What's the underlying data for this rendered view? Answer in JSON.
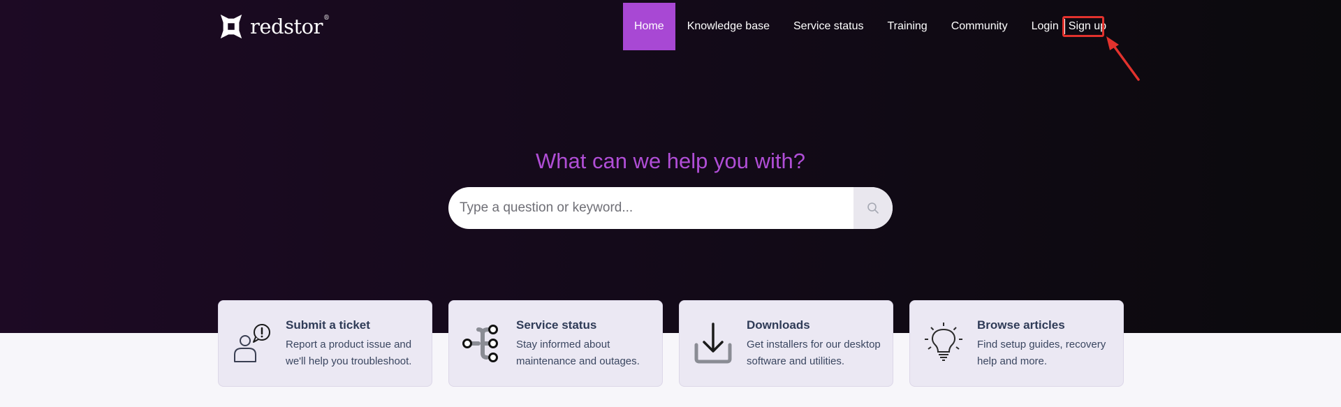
{
  "brand": {
    "name": "redstor",
    "tm": "®"
  },
  "nav": {
    "items": [
      {
        "label": "Home",
        "active": true
      },
      {
        "label": "Knowledge base",
        "active": false
      },
      {
        "label": "Service status",
        "active": false
      },
      {
        "label": "Training",
        "active": false
      },
      {
        "label": "Community",
        "active": false
      },
      {
        "label": "Login",
        "active": false
      },
      {
        "label": "Sign up",
        "active": false
      }
    ]
  },
  "hero": {
    "title": "What can we help you with?",
    "search_placeholder": "Type a question or keyword..."
  },
  "cards": [
    {
      "title": "Submit a ticket",
      "desc_line1": "Report a product issue and",
      "desc_line2": "we'll help you troubleshoot.",
      "icon": "user-alert-icon"
    },
    {
      "title": "Service status",
      "desc_line1": "Stay informed about",
      "desc_line2": "maintenance and outages.",
      "icon": "network-nodes-icon"
    },
    {
      "title": "Downloads",
      "desc_line1": "Get installers for our desktop",
      "desc_line2": "software and utilities.",
      "icon": "download-tray-icon"
    },
    {
      "title": "Browse articles",
      "desc_line1": "Find setup guides, recovery",
      "desc_line2": "help and more.",
      "icon": "lightbulb-icon"
    }
  ],
  "colors": {
    "accent": "#a848d4",
    "headline": "#b04ed6",
    "annotation": "#e2322d",
    "card_bg": "#ebe8f3",
    "card_text": "#2f3b57"
  }
}
